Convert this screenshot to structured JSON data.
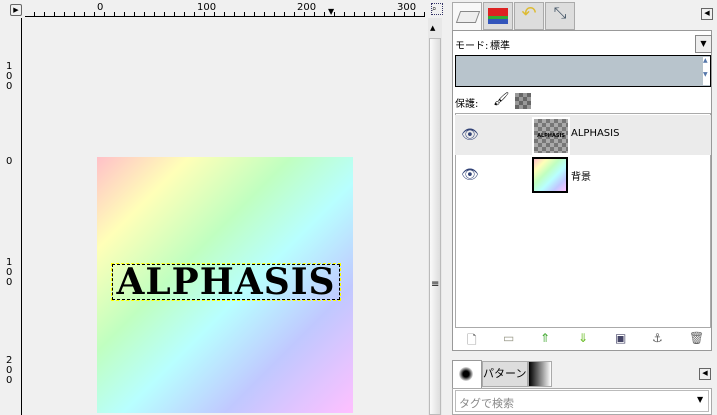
{
  "rulers": {
    "h_labels": [
      "0",
      "100",
      "200",
      "300"
    ],
    "v_labels": [
      "1\n0\n0",
      "0",
      "1\n0\n0",
      "2\n0\n0"
    ]
  },
  "canvas": {
    "text_layer": "ALPHASIS"
  },
  "layers_panel": {
    "tabs": [
      "layers",
      "channels",
      "undo-history",
      "paths"
    ],
    "mode_label": "モード:",
    "mode_value": "標準",
    "lock_label": "保護:",
    "layers": [
      {
        "name": "ALPHASIS",
        "visible": true,
        "selected": true
      },
      {
        "name": "背景",
        "visible": true,
        "selected": false
      }
    ],
    "buttons": [
      "new-layer",
      "new-group",
      "raise-layer",
      "lower-layer",
      "duplicate-layer",
      "anchor-layer",
      "delete-layer"
    ]
  },
  "brush_panel": {
    "tab_label": "パターン",
    "tag_placeholder": "タグで検索"
  },
  "colors": {
    "selection": "#ffff00",
    "panel_bg": "#b8c4cc"
  }
}
